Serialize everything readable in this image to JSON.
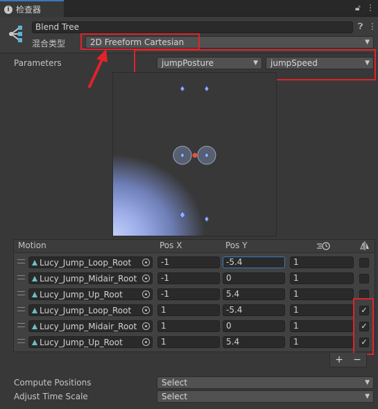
{
  "tab": {
    "title": "检查器",
    "icon": "info-icon"
  },
  "header": {
    "name": "Blend Tree",
    "blend_type_label": "混合类型",
    "blend_type_value": "2D Freeform Cartesian"
  },
  "parameters": {
    "label": "Parameters",
    "param_x": "jumpPosture",
    "param_y": "jumpSpeed"
  },
  "table": {
    "headers": {
      "motion": "Motion",
      "pos_x": "Pos X",
      "pos_y": "Pos Y",
      "time_scale_icon": "time-scale-icon",
      "mirror_icon": "mirror-icon"
    },
    "rows": [
      {
        "motion": "Lucy_Jump_Loop_Root",
        "pos_x": "-1",
        "pos_y": "-5.4",
        "speed": "1",
        "mirror": ""
      },
      {
        "motion": "Lucy_Jump_Midair_Root",
        "pos_x": "-1",
        "pos_y": "0",
        "speed": "1",
        "mirror": ""
      },
      {
        "motion": "Lucy_Jump_Up_Root",
        "pos_x": "-1",
        "pos_y": "5.4",
        "speed": "1",
        "mirror": ""
      },
      {
        "motion": "Lucy_Jump_Loop_Root",
        "pos_x": "1",
        "pos_y": "-5.4",
        "speed": "1",
        "mirror": "✓"
      },
      {
        "motion": "Lucy_Jump_Midair_Root",
        "pos_x": "1",
        "pos_y": "0",
        "speed": "1",
        "mirror": "✓"
      },
      {
        "motion": "Lucy_Jump_Up_Root",
        "pos_x": "1",
        "pos_y": "5.4",
        "speed": "1",
        "mirror": "✓"
      }
    ],
    "add_label": "+",
    "remove_label": "−"
  },
  "compute_positions": {
    "label": "Compute Positions",
    "value": "Select"
  },
  "adjust_time_scale": {
    "label": "Adjust Time Scale",
    "value": "Select"
  },
  "colors": {
    "accent": "#3a79bb",
    "highlight": "#e0232b",
    "point": "#8fb0ff"
  }
}
